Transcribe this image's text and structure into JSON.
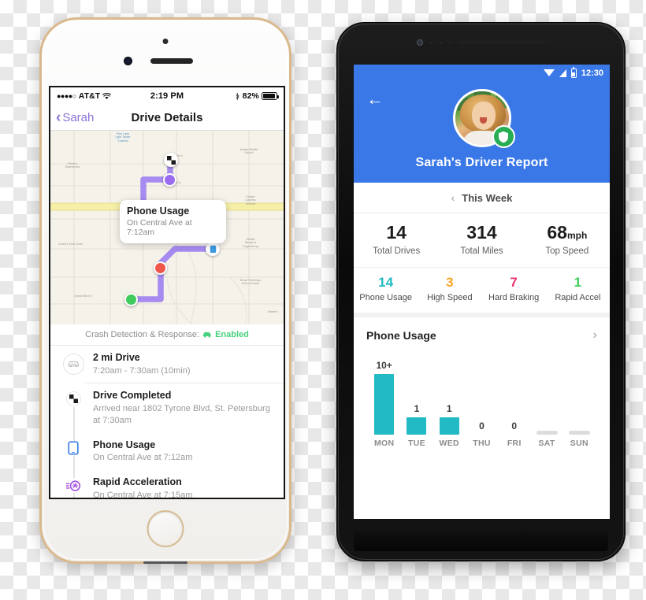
{
  "iphone": {
    "status_bar": {
      "carrier_dots": "●●●●○",
      "carrier": "AT&T",
      "wifi_icon": "wifi-icon",
      "time": "2:19 PM",
      "bluetooth_icon": "bluetooth-icon",
      "battery_percent": "82%"
    },
    "nav": {
      "back_label": "Sarah",
      "back_chevron": "‹",
      "title": "Drive Details"
    },
    "map": {
      "callout": {
        "title": "Phone Usage",
        "subtitle": "On Central Ave at 7:12am"
      },
      "labels": [
        {
          "name": "Pine Lake Light Tackle Charters",
          "kind": "blue"
        },
        {
          "name": "Azalea Middle School",
          "kind": "poi"
        },
        {
          "name": "Riviera Waterworks",
          "kind": "poi"
        },
        {
          "name": "Kimble Cypress Schools",
          "kind": "poi"
        },
        {
          "name": "Seattle Design & Engineering",
          "kind": "poi"
        },
        {
          "name": "Bruce Flannings Gold Services",
          "kind": "poi"
        },
        {
          "name": "Jimmie's",
          "kind": "poi"
        }
      ],
      "street_labels": [
        "Country Club Circle",
        "Tyrone Blvd N",
        "35th Ave N",
        "38th Ave N",
        "Ave N"
      ],
      "markers": [
        {
          "name": "finish-flag-marker",
          "color": "#f2f2f2"
        },
        {
          "name": "purple-event-marker",
          "color": "#9b6cf0"
        },
        {
          "name": "phone-usage-marker",
          "color": "#3b9ae0"
        },
        {
          "name": "hard-braking-marker",
          "color": "#f0564a"
        },
        {
          "name": "start-marker",
          "color": "#3fcc5c"
        }
      ],
      "route_color": "#a78bf0"
    },
    "crash_banner": {
      "label": "Crash Detection & Response:",
      "status": "Enabled",
      "icon": "crash-car-icon"
    },
    "events": [
      {
        "icon": "car-icon",
        "title": "2 mi Drive",
        "subtitle": "7:20am - 7:30am (10min)"
      },
      {
        "icon": "checkered-flag-icon",
        "title": "Drive Completed",
        "subtitle": "Arrived near 1802 Tyrone Blvd, St. Petersburg at 7:30am"
      },
      {
        "icon": "phone-icon",
        "title": "Phone Usage",
        "subtitle": "On Central Ave at 7:12am"
      },
      {
        "icon": "rapid-accel-icon",
        "title": "Rapid Acceleration",
        "subtitle": "On Central Ave at 7:15am"
      }
    ]
  },
  "android": {
    "status_bar": {
      "wifi_icon": "wifi-icon",
      "signal_icon": "signal-icon",
      "battery_icon": "battery-icon",
      "time": "12:30"
    },
    "header": {
      "back_arrow": "←",
      "avatar": "user-avatar",
      "shield_badge": "shield-verified-icon",
      "title": "Sarah's Driver Report",
      "background_color": "#3b78e7"
    },
    "week_selector": {
      "chevron": "‹",
      "label": "This Week"
    },
    "summary_stats": [
      {
        "value": "14",
        "unit": "",
        "label": "Total Drives"
      },
      {
        "value": "314",
        "unit": "",
        "label": "Total Miles"
      },
      {
        "value": "68",
        "unit": "mph",
        "label": "Top Speed"
      }
    ],
    "event_stats": [
      {
        "value": "14",
        "label": "Phone Usage",
        "color": "#22bac4"
      },
      {
        "value": "3",
        "label": "High Speed",
        "color": "#f5a623"
      },
      {
        "value": "7",
        "label": "Hard Braking",
        "color": "#e8356d"
      },
      {
        "value": "1",
        "label": "Rapid Accel",
        "color": "#3fcc5c"
      }
    ],
    "phone_usage_card": {
      "title": "Phone Usage",
      "arrow": "›"
    },
    "chart_data": {
      "type": "bar",
      "title": "Phone Usage",
      "categories": [
        "MON",
        "TUE",
        "WED",
        "THU",
        "FRI",
        "SAT",
        "SUN"
      ],
      "values": [
        10,
        1,
        1,
        0,
        0,
        0,
        0
      ],
      "value_labels": [
        "10+",
        "1",
        "1",
        "0",
        "0",
        "",
        ""
      ],
      "bar_color": "#22bac4",
      "empty_bar_color": "#dcdcdc",
      "xlabel": "",
      "ylabel": "",
      "ylim": [
        0,
        10
      ],
      "grid": false,
      "legend": false
    }
  }
}
